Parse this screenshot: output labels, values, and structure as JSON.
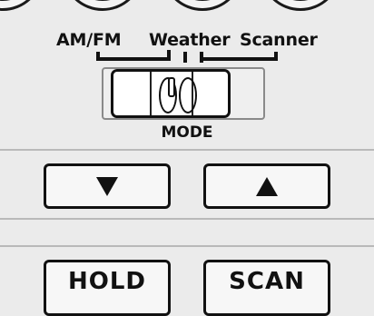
{
  "mode_switch": {
    "positions": [
      "AM/FM",
      "Weather",
      "Scanner"
    ],
    "label": "MODE"
  },
  "arrows": {
    "down_icon": "triangle-down-icon",
    "up_icon": "triangle-up-icon"
  },
  "buttons": {
    "hold_label": "HOLD",
    "scan_label": "SCAN"
  },
  "colors": {
    "panel": "#ebebeb",
    "ink": "#111111",
    "divider": "#b9b9b9"
  }
}
